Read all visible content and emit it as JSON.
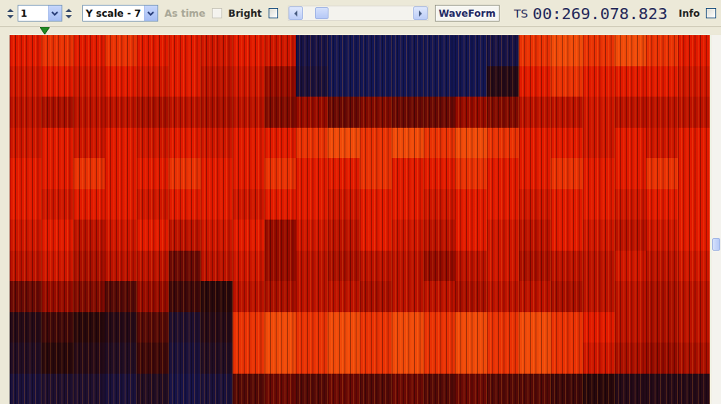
{
  "toolbar": {
    "channel_select": {
      "value": "1"
    },
    "y_scale_select": {
      "value": "Y scale - 7"
    },
    "as_time": {
      "label": "As time",
      "checked": false,
      "disabled": true
    },
    "bright": {
      "label": "Bright",
      "checked": false
    },
    "scroll": {
      "level": 0.12
    },
    "waveform_button": {
      "label": "WaveForm"
    },
    "timestamp": {
      "label": "TS",
      "value": "00:269.078.823"
    },
    "info": {
      "label": "Info",
      "checked": false
    }
  },
  "marker": {
    "level": 0.05
  },
  "spectrogram": {
    "rows": [
      [
        0.8,
        0.85,
        0.8,
        0.85,
        0.8,
        0.8,
        0.75,
        0.8,
        0.75,
        0.1,
        0.05,
        0.05,
        0.05,
        0.05,
        0.05,
        0.1,
        0.85,
        0.9,
        0.85,
        0.9,
        0.85,
        0.8
      ],
      [
        0.75,
        0.8,
        0.75,
        0.8,
        0.75,
        0.8,
        0.7,
        0.75,
        0.6,
        0.15,
        0.05,
        0.05,
        0.05,
        0.05,
        0.05,
        0.3,
        0.8,
        0.85,
        0.8,
        0.8,
        0.8,
        0.75
      ],
      [
        0.7,
        0.65,
        0.7,
        0.7,
        0.65,
        0.7,
        0.65,
        0.7,
        0.55,
        0.6,
        0.5,
        0.55,
        0.5,
        0.5,
        0.6,
        0.55,
        0.7,
        0.7,
        0.75,
        0.7,
        0.7,
        0.7
      ],
      [
        0.75,
        0.8,
        0.75,
        0.8,
        0.75,
        0.8,
        0.75,
        0.8,
        0.8,
        0.85,
        0.9,
        0.85,
        0.9,
        0.85,
        0.9,
        0.85,
        0.8,
        0.8,
        0.75,
        0.8,
        0.75,
        0.8
      ],
      [
        0.8,
        0.8,
        0.85,
        0.8,
        0.8,
        0.85,
        0.8,
        0.8,
        0.85,
        0.8,
        0.8,
        0.85,
        0.8,
        0.8,
        0.85,
        0.8,
        0.8,
        0.85,
        0.8,
        0.8,
        0.85,
        0.8
      ],
      [
        0.8,
        0.75,
        0.8,
        0.8,
        0.75,
        0.8,
        0.8,
        0.75,
        0.8,
        0.8,
        0.75,
        0.8,
        0.8,
        0.75,
        0.8,
        0.8,
        0.75,
        0.8,
        0.8,
        0.75,
        0.8,
        0.8
      ],
      [
        0.75,
        0.8,
        0.7,
        0.75,
        0.8,
        0.7,
        0.75,
        0.8,
        0.6,
        0.75,
        0.7,
        0.8,
        0.75,
        0.7,
        0.8,
        0.75,
        0.7,
        0.8,
        0.75,
        0.7,
        0.75,
        0.8
      ],
      [
        0.7,
        0.75,
        0.65,
        0.7,
        0.7,
        0.5,
        0.7,
        0.75,
        0.6,
        0.7,
        0.65,
        0.7,
        0.7,
        0.6,
        0.7,
        0.75,
        0.65,
        0.7,
        0.7,
        0.75,
        0.7,
        0.75
      ],
      [
        0.5,
        0.6,
        0.55,
        0.45,
        0.6,
        0.4,
        0.35,
        0.7,
        0.65,
        0.7,
        0.7,
        0.65,
        0.7,
        0.7,
        0.65,
        0.7,
        0.7,
        0.65,
        0.7,
        0.7,
        0.65,
        0.7
      ],
      [
        0.3,
        0.4,
        0.35,
        0.3,
        0.45,
        0.2,
        0.3,
        0.85,
        0.9,
        0.85,
        0.9,
        0.85,
        0.9,
        0.85,
        0.9,
        0.85,
        0.9,
        0.85,
        0.8,
        0.7,
        0.65,
        0.7
      ],
      [
        0.25,
        0.35,
        0.3,
        0.25,
        0.4,
        0.15,
        0.25,
        0.85,
        0.9,
        0.85,
        0.9,
        0.85,
        0.9,
        0.85,
        0.9,
        0.85,
        0.9,
        0.85,
        0.75,
        0.65,
        0.6,
        0.65
      ],
      [
        0.15,
        0.2,
        0.2,
        0.15,
        0.25,
        0.1,
        0.15,
        0.45,
        0.5,
        0.45,
        0.5,
        0.45,
        0.5,
        0.45,
        0.5,
        0.45,
        0.45,
        0.4,
        0.35,
        0.3,
        0.3,
        0.3
      ]
    ]
  },
  "v_scroll": {
    "level": 0.57
  }
}
